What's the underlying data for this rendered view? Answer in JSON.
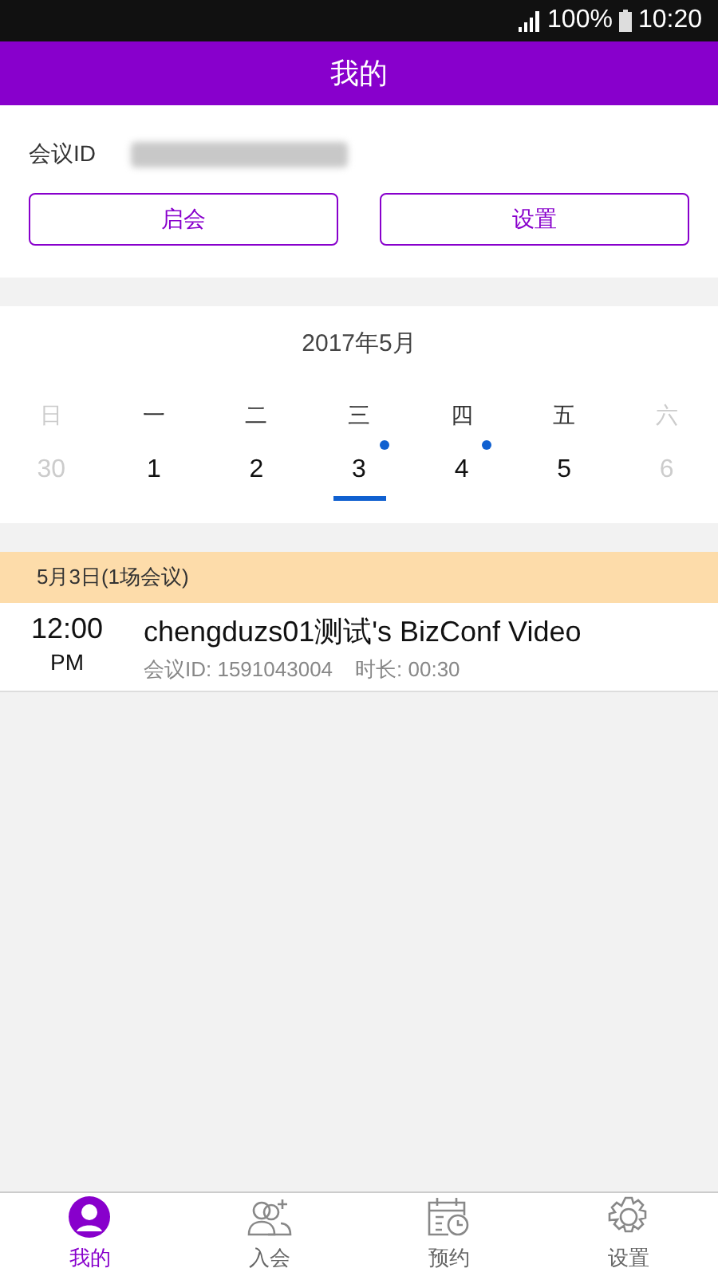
{
  "status_bar": {
    "battery": "100%",
    "time": "10:20"
  },
  "header": {
    "title": "我的"
  },
  "meeting_id": {
    "label": "会议ID"
  },
  "buttons": [
    "启会",
    "设置"
  ],
  "calendar": {
    "month": "2017年5月",
    "weekdays": [
      {
        "label": "日",
        "muted": true
      },
      {
        "label": "一",
        "muted": false
      },
      {
        "label": "二",
        "muted": false
      },
      {
        "label": "三",
        "muted": false
      },
      {
        "label": "四",
        "muted": false
      },
      {
        "label": "五",
        "muted": false
      },
      {
        "label": "六",
        "muted": true
      }
    ],
    "days": [
      {
        "label": "30",
        "muted": true,
        "has_meeting": false,
        "selected": false
      },
      {
        "label": "1",
        "muted": false,
        "has_meeting": false,
        "selected": false
      },
      {
        "label": "2",
        "muted": false,
        "has_meeting": false,
        "selected": false
      },
      {
        "label": "3",
        "muted": false,
        "has_meeting": true,
        "selected": true
      },
      {
        "label": "4",
        "muted": false,
        "has_meeting": true,
        "selected": false
      },
      {
        "label": "5",
        "muted": false,
        "has_meeting": false,
        "selected": false
      },
      {
        "label": "6",
        "muted": true,
        "has_meeting": false,
        "selected": false
      }
    ]
  },
  "day_header": "5月3日(1场会议)",
  "meetings": [
    {
      "time": "12:00",
      "ampm": "PM",
      "title": "chengduzs01测试's BizConf Video",
      "meeting_id": "会议ID: 1591043004",
      "duration": "时长: 00:30"
    }
  ],
  "tabs": [
    {
      "label": "我的",
      "kind": "person",
      "selected": true
    },
    {
      "label": "入会",
      "kind": "people",
      "selected": false
    },
    {
      "label": "预约",
      "kind": "calendar",
      "selected": false
    },
    {
      "label": "设置",
      "kind": "gear",
      "selected": false
    }
  ]
}
